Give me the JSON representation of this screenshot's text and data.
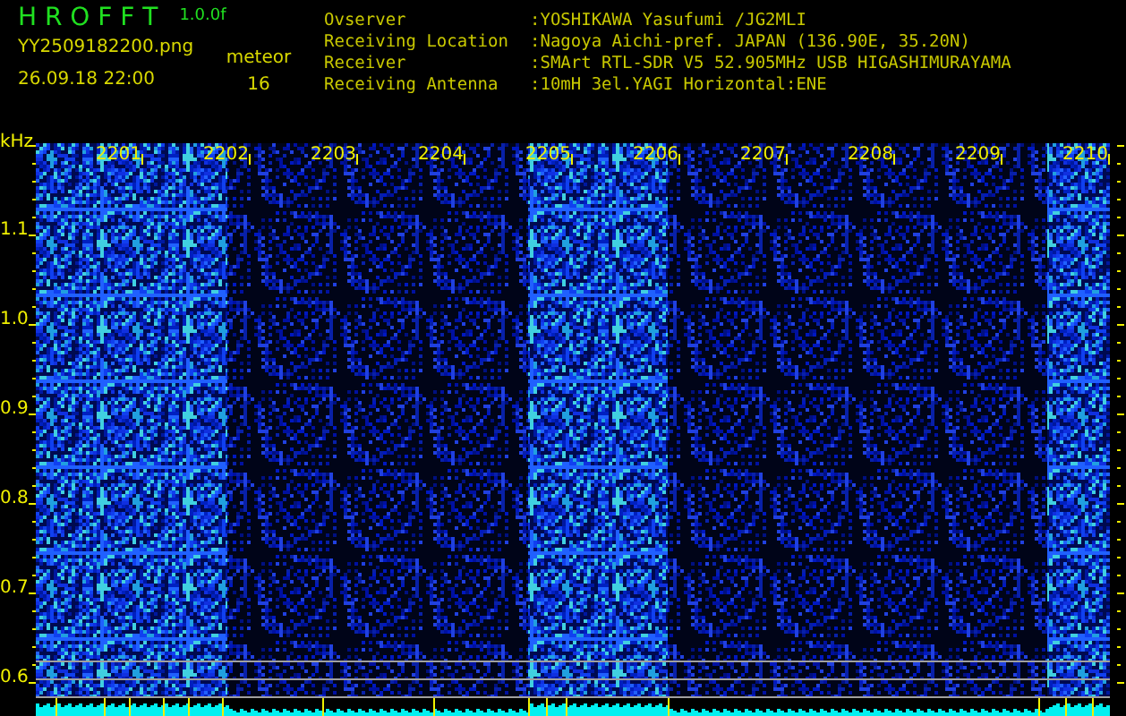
{
  "app": {
    "title": "H R O F F T",
    "version": "1.0.0f",
    "filename": "YY2509182200.png",
    "timestamp": "26.09.18 22:00",
    "counter_label": "meteor",
    "counter_value": "16"
  },
  "station_info": [
    {
      "label": "Ovserver",
      "value": ":YOSHIKAWA Yasufumi /JG2MLI"
    },
    {
      "label": "Receiving Location",
      "value": ":Nagoya Aichi-pref. JAPAN (136.90E, 35.20N)"
    },
    {
      "label": "Receiver",
      "value": ":SMArt RTL-SDR V5 52.905MHz USB HIGASHIMURAYAMA"
    },
    {
      "label": "Receiving Antenna",
      "value": ":10mH 3el.YAGI Horizontal:ENE"
    }
  ],
  "spectrogram": {
    "y_unit": "kHz",
    "y_labels": [
      "1.1",
      "1.0",
      "0.9",
      "0.8",
      "0.7",
      "0.6"
    ],
    "time_labels": [
      "2201",
      "2202",
      "2203",
      "2204",
      "2205",
      "2206",
      "2207",
      "2208",
      "2209",
      "2210"
    ]
  }
}
